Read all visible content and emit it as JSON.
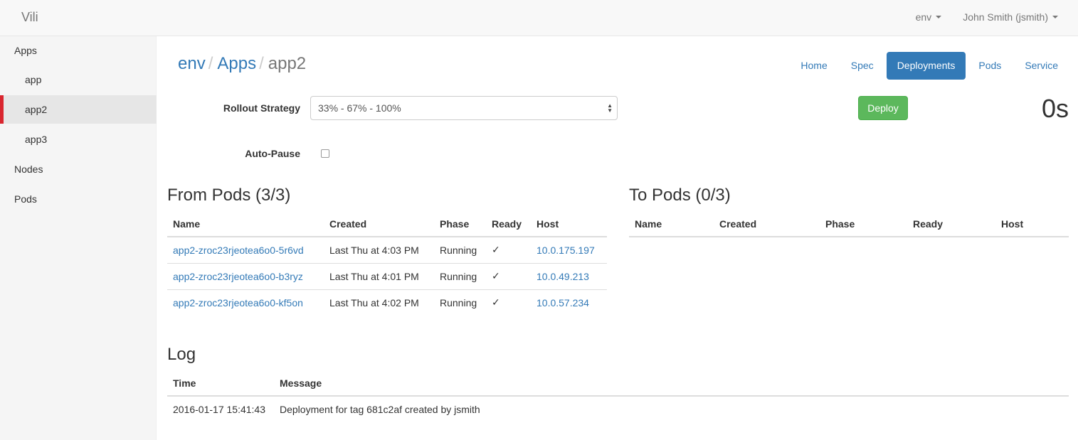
{
  "navbar": {
    "brand": "Vili",
    "env_dropdown": "env",
    "user_dropdown": "John Smith (jsmith)"
  },
  "sidebar": {
    "items": [
      {
        "label": "Apps"
      },
      {
        "label": "app"
      },
      {
        "label": "app2"
      },
      {
        "label": "app3"
      },
      {
        "label": "Nodes"
      },
      {
        "label": "Pods"
      }
    ]
  },
  "breadcrumb": {
    "env": "env",
    "apps": "Apps",
    "current": "app2",
    "separator": "/"
  },
  "tabs": [
    {
      "label": "Home"
    },
    {
      "label": "Spec"
    },
    {
      "label": "Deployments"
    },
    {
      "label": "Pods"
    },
    {
      "label": "Service"
    }
  ],
  "form": {
    "rollout_label": "Rollout Strategy",
    "rollout_value": "33% - 67% - 100%",
    "autopause_label": "Auto-Pause",
    "deploy_label": "Deploy",
    "timer": "0s"
  },
  "from_pods": {
    "title": "From Pods (3/3)",
    "headers": [
      "Name",
      "Created",
      "Phase",
      "Ready",
      "Host"
    ],
    "rows": [
      {
        "name": "app2-zroc23rjeotea6o0-5r6vd",
        "created": "Last Thu at 4:03 PM",
        "phase": "Running",
        "ready": "✓",
        "host": "10.0.175.197"
      },
      {
        "name": "app2-zroc23rjeotea6o0-b3ryz",
        "created": "Last Thu at 4:01 PM",
        "phase": "Running",
        "ready": "✓",
        "host": "10.0.49.213"
      },
      {
        "name": "app2-zroc23rjeotea6o0-kf5on",
        "created": "Last Thu at 4:02 PM",
        "phase": "Running",
        "ready": "✓",
        "host": "10.0.57.234"
      }
    ]
  },
  "to_pods": {
    "title": "To Pods (0/3)",
    "headers": [
      "Name",
      "Created",
      "Phase",
      "Ready",
      "Host"
    ]
  },
  "log": {
    "title": "Log",
    "headers": [
      "Time",
      "Message"
    ],
    "rows": [
      {
        "time": "2016-01-17 15:41:43",
        "message": "Deployment for tag 681c2af created by jsmith"
      }
    ]
  },
  "colors": {
    "primary": "#337ab7",
    "success": "#5cb85c",
    "active_marker": "#d9262f"
  }
}
